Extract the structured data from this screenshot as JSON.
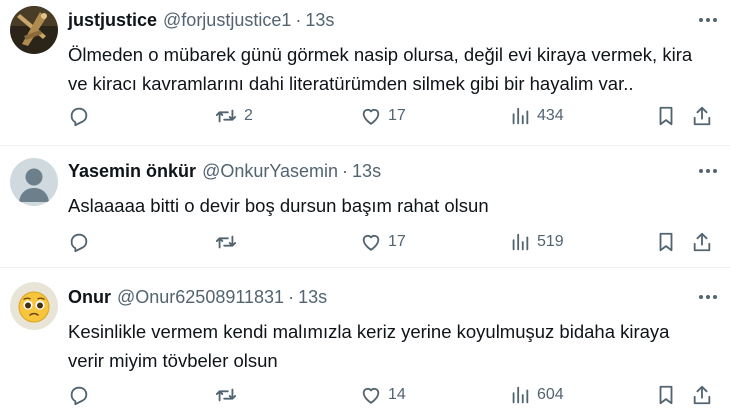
{
  "colors": {
    "text": "#0f1419",
    "secondary": "#536471",
    "divider": "#eff3f4"
  },
  "tweets": [
    {
      "name": "justjustice",
      "handle": "@forjustjustice1",
      "dot": "·",
      "time": "13s",
      "text_lines": [
        "Ölmeden o mübarek günü görmek nasip olursa, değil evi kiraya vermek, kira",
        "ve kiracı kavramlarını dahi literatürümden silmek gibi bir hayalim var.."
      ],
      "retweets": "2",
      "likes": "17",
      "views": "434",
      "avatar": "logo-avatar"
    },
    {
      "name": "Yasemin önkür",
      "handle": "@OnkurYasemin",
      "dot": "·",
      "time": "13s",
      "text_lines": [
        "Aslaaaaa bitti o devir boş dursun başım rahat olsun"
      ],
      "retweets": "",
      "likes": "17",
      "views": "519",
      "avatar": "default-person-avatar"
    },
    {
      "name": "Onur",
      "handle": "@Onur62508911831",
      "dot": "·",
      "time": "13s",
      "text_lines": [
        "Kesinlikle vermem kendi malımızla keriz yerine koyulmuşuz bidaha kiraya",
        "verir miyim tövbeler olsun"
      ],
      "retweets": "",
      "likes": "14",
      "views": "604",
      "avatar": "pleading-face-emoji-avatar"
    }
  ]
}
